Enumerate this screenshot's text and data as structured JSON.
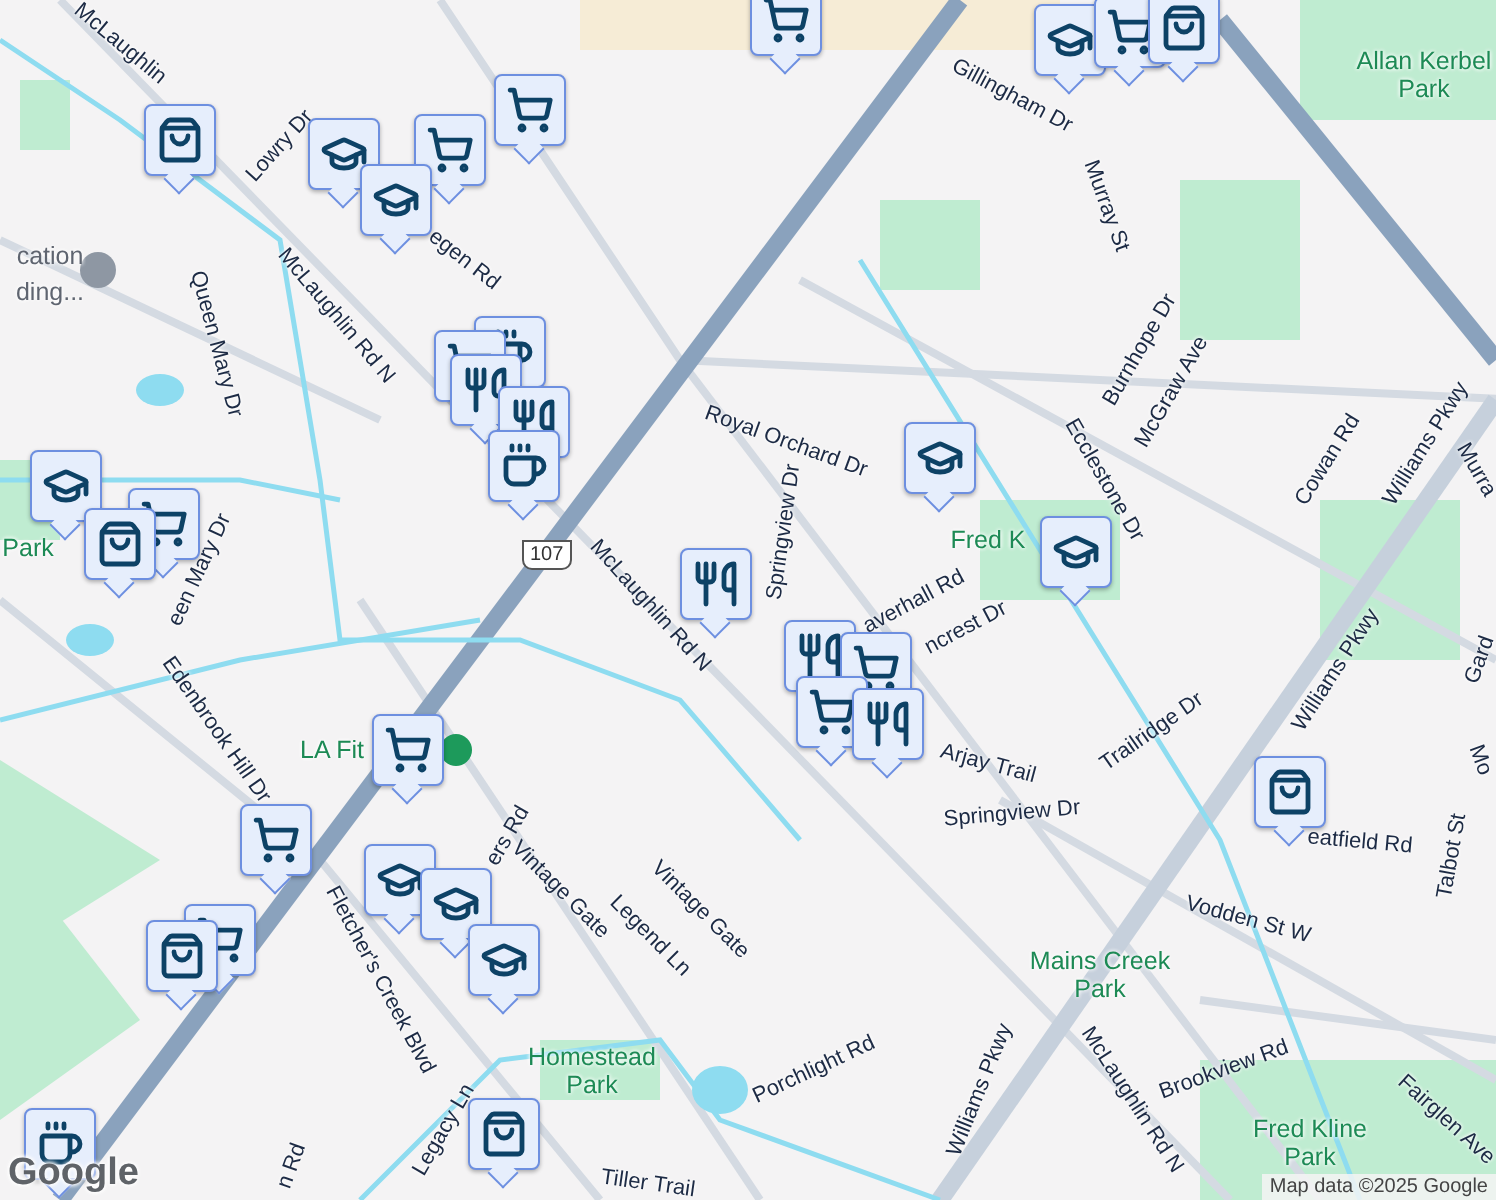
{
  "map": {
    "labels": [
      {
        "text": "McLaughlin",
        "kind": "street"
      },
      {
        "text": "Lowry Dr",
        "kind": "street"
      },
      {
        "text": "egen Rd",
        "kind": "street"
      },
      {
        "text": "McLaughlin Rd N",
        "kind": "street"
      },
      {
        "text": "Queen Mary Dr",
        "kind": "street"
      },
      {
        "text": "een Mary Dr",
        "kind": "street"
      },
      {
        "text": "Gillingham Dr",
        "kind": "street"
      },
      {
        "text": "Murray St",
        "kind": "street"
      },
      {
        "text": "Burnhope Dr",
        "kind": "street"
      },
      {
        "text": "McGraw Ave",
        "kind": "street"
      },
      {
        "text": "Ecclestone Dr",
        "kind": "street"
      },
      {
        "text": "Cowan Rd",
        "kind": "street"
      },
      {
        "text": "Williams Pkwy",
        "kind": "street"
      },
      {
        "text": "Murra",
        "kind": "street"
      },
      {
        "text": "Royal Orchard Dr",
        "kind": "street"
      },
      {
        "text": "Springview Dr",
        "kind": "street"
      },
      {
        "text": "McLaughlin Rd N",
        "kind": "street"
      },
      {
        "text": "averhall Rd",
        "kind": "street"
      },
      {
        "text": "ncrest Dr",
        "kind": "street"
      },
      {
        "text": "Arjay Trail",
        "kind": "street"
      },
      {
        "text": "Trailridge Dr",
        "kind": "street"
      },
      {
        "text": "Springview Dr",
        "kind": "street"
      },
      {
        "text": "Williams Pkwy",
        "kind": "street"
      },
      {
        "text": "eatfield Rd",
        "kind": "street"
      },
      {
        "text": "Talbot St",
        "kind": "street"
      },
      {
        "text": "Gard",
        "kind": "street"
      },
      {
        "text": "Mo",
        "kind": "street"
      },
      {
        "text": "Vodden St W",
        "kind": "street"
      },
      {
        "text": "Brookview Rd",
        "kind": "street"
      },
      {
        "text": "Fairglen Ave",
        "kind": "street"
      },
      {
        "text": "McLaughlin Rd N",
        "kind": "street"
      },
      {
        "text": "Williams Pkwy",
        "kind": "street"
      },
      {
        "text": "Porchlight Rd",
        "kind": "street"
      },
      {
        "text": "Tiller Trail",
        "kind": "street"
      },
      {
        "text": "Legacy Ln",
        "kind": "street"
      },
      {
        "text": "n Rd",
        "kind": "street"
      },
      {
        "text": "Fletcher's Creek Blvd",
        "kind": "street"
      },
      {
        "text": "ers Rd",
        "kind": "street"
      },
      {
        "text": "Vintage Gate",
        "kind": "street"
      },
      {
        "text": "Legend Ln",
        "kind": "street"
      },
      {
        "text": "Vintage Gate",
        "kind": "street"
      },
      {
        "text": "Edenbrook Hill Dr",
        "kind": "street"
      },
      {
        "text": "Allan Kerbel Park",
        "kind": "park"
      },
      {
        "text": "Fred K",
        "kind": "park"
      },
      {
        "text": "Mains Creek Park",
        "kind": "park"
      },
      {
        "text": "Fred Kline Park",
        "kind": "park"
      },
      {
        "text": "Homestead Park",
        "kind": "park"
      },
      {
        "text": "Park",
        "kind": "park"
      },
      {
        "text": "LA Fit",
        "kind": "park"
      },
      {
        "text": "cation",
        "kind": "poi"
      },
      {
        "text": "ding...",
        "kind": "poi"
      }
    ],
    "markers": [
      {
        "kind": "bag"
      },
      {
        "kind": "cart"
      },
      {
        "kind": "school"
      },
      {
        "kind": "cart"
      },
      {
        "kind": "bag"
      },
      {
        "kind": "cart"
      },
      {
        "kind": "school"
      },
      {
        "kind": "cart"
      },
      {
        "kind": "school"
      },
      {
        "kind": "coffee"
      },
      {
        "kind": "cart"
      },
      {
        "kind": "food"
      },
      {
        "kind": "food"
      },
      {
        "kind": "coffee"
      },
      {
        "kind": "school"
      },
      {
        "kind": "cart"
      },
      {
        "kind": "bag"
      },
      {
        "kind": "food"
      },
      {
        "kind": "school"
      },
      {
        "kind": "school"
      },
      {
        "kind": "food"
      },
      {
        "kind": "cart"
      },
      {
        "kind": "cart"
      },
      {
        "kind": "food"
      },
      {
        "kind": "cart"
      },
      {
        "kind": "cart"
      },
      {
        "kind": "school"
      },
      {
        "kind": "school"
      },
      {
        "kind": "school"
      },
      {
        "kind": "cart"
      },
      {
        "kind": "bag"
      },
      {
        "kind": "bag"
      },
      {
        "kind": "bag"
      },
      {
        "kind": "coffee"
      }
    ],
    "highway_shield": "107",
    "logo": "Google",
    "attribution": "Map data ©2025 Google"
  }
}
